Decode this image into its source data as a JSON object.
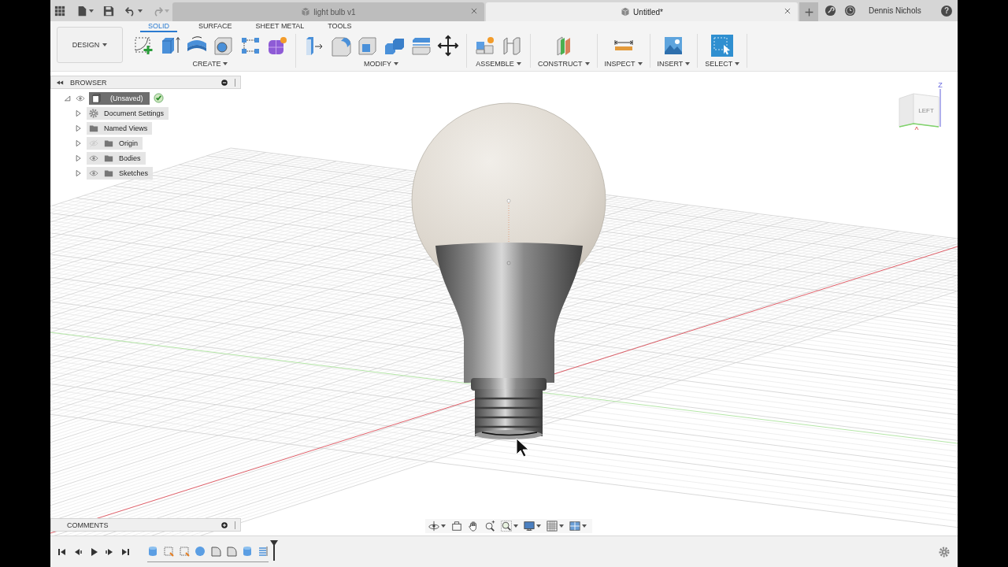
{
  "title_bar": {
    "actions": [
      {
        "kind": "undo",
        "disabled": false
      },
      {
        "kind": "redo",
        "disabled": true
      }
    ],
    "tabs": [
      {
        "label": "light bulb v1",
        "selected": false
      },
      {
        "label": "Untitled*",
        "selected": true
      }
    ],
    "user": "Dennis Nichols",
    "help": "?"
  },
  "toolbar": {
    "workspace": "DESIGN",
    "tabs": [
      {
        "label": "SOLID",
        "selected": true
      },
      {
        "label": "SURFACE",
        "selected": false
      },
      {
        "label": "SHEET METAL",
        "selected": false
      },
      {
        "label": "TOOLS",
        "selected": false
      }
    ],
    "groups": [
      {
        "label": "CREATE",
        "tools": [
          {
            "kind": "sketch"
          },
          {
            "kind": "box"
          },
          {
            "kind": "revolve"
          },
          {
            "kind": "hole"
          },
          {
            "kind": "pattern"
          },
          {
            "kind": "form"
          }
        ]
      },
      {
        "label": "MODIFY",
        "tools": [
          {
            "kind": "press-pull"
          },
          {
            "kind": "fillet"
          },
          {
            "kind": "shell"
          },
          {
            "kind": "combine"
          },
          {
            "kind": "split"
          },
          {
            "kind": "move"
          }
        ]
      },
      {
        "label": "ASSEMBLE",
        "tools": [
          {
            "kind": "component"
          },
          {
            "kind": "joint"
          }
        ]
      },
      {
        "label": "CONSTRUCT",
        "tools": [
          {
            "kind": "plane"
          }
        ]
      },
      {
        "label": "INSPECT",
        "tools": [
          {
            "kind": "measure"
          }
        ]
      },
      {
        "label": "INSERT",
        "tools": [
          {
            "kind": "image"
          }
        ]
      },
      {
        "label": "SELECT",
        "tools": [
          {
            "kind": "select"
          }
        ]
      }
    ]
  },
  "browser": {
    "title": "BROWSER",
    "tree": [
      {
        "label": "(Unsaved)",
        "kind": "component",
        "visible": true,
        "expanded": true,
        "selected": true,
        "children": [
          {
            "label": "Document Settings",
            "kind": "settings",
            "expanded": false,
            "selected": false
          },
          {
            "label": "Named Views",
            "kind": "folder",
            "expanded": false,
            "selected": false
          },
          {
            "label": "Origin",
            "kind": "folder",
            "visible": false,
            "expanded": false,
            "selected": false
          },
          {
            "label": "Bodies",
            "kind": "folder",
            "visible": true,
            "expanded": false,
            "selected": false
          },
          {
            "label": "Sketches",
            "kind": "folder",
            "visible": true,
            "expanded": false,
            "selected": false
          }
        ]
      }
    ]
  },
  "comments": {
    "title": "COMMENTS"
  },
  "view_cube": {
    "face": "LEFT",
    "axis": "Z"
  },
  "nav_bar": {
    "tools": [
      {
        "kind": "orbit",
        "menu": true
      },
      {
        "kind": "look-at",
        "menu": false
      },
      {
        "kind": "pan",
        "menu": false
      },
      {
        "kind": "zoom",
        "menu": false
      },
      {
        "kind": "fit",
        "menu": true
      },
      {
        "kind": "display",
        "menu": true
      },
      {
        "kind": "grid",
        "menu": true
      },
      {
        "kind": "viewports",
        "menu": true
      }
    ]
  },
  "timeline": {
    "controls": [
      {
        "kind": "first"
      },
      {
        "kind": "prev"
      },
      {
        "kind": "play"
      },
      {
        "kind": "next"
      },
      {
        "kind": "last"
      }
    ],
    "features": [
      {
        "kind": "body"
      },
      {
        "kind": "sketch"
      },
      {
        "kind": "sketch"
      },
      {
        "kind": "sphere"
      },
      {
        "kind": "fillet"
      },
      {
        "kind": "fillet"
      },
      {
        "kind": "body"
      },
      {
        "kind": "coil"
      }
    ]
  }
}
